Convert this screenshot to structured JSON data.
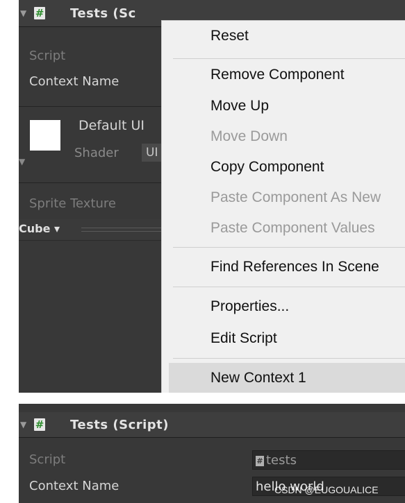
{
  "top": {
    "header": {
      "title": "Tests (Sc",
      "foldout": "▼",
      "icon_glyph": "#"
    },
    "fields": {
      "script_label": "Script",
      "context_name_label": "Context Name"
    },
    "material": {
      "name": "Default UI",
      "shader_label": "Shader",
      "shader_value": "UI",
      "foldout": "▼"
    },
    "sprite_texture_label": "Sprite Texture",
    "toolbar": {
      "dropdown": "Cube ▾"
    },
    "context_menu": {
      "items": [
        {
          "label": "Reset",
          "enabled": true
        },
        {
          "label": "Remove Component",
          "enabled": true
        },
        {
          "label": "Move Up",
          "enabled": true
        },
        {
          "label": "Move Down",
          "enabled": false
        },
        {
          "label": "Copy Component",
          "enabled": true
        },
        {
          "label": "Paste Component As New",
          "enabled": false
        },
        {
          "label": "Paste Component Values",
          "enabled": false
        },
        {
          "label": "Find References In Scene",
          "enabled": true
        },
        {
          "label": "Properties...",
          "enabled": true
        },
        {
          "label": "Edit Script",
          "enabled": true
        },
        {
          "label": "New Context 1",
          "enabled": true,
          "highlighted": true
        }
      ]
    }
  },
  "bottom": {
    "header": {
      "title": "Tests (Script)",
      "foldout": "▼",
      "icon_glyph": "#"
    },
    "fields": {
      "script_label": "Script",
      "script_value": "tests",
      "context_name_label": "Context Name",
      "context_name_value": "hello world"
    },
    "watermark": "CSDN @EUGOUALICE"
  },
  "colors": {
    "panel_bg": "#383838",
    "menu_bg": "#f0f0f0",
    "menu_highlight": "#dadada",
    "script_icon_green": "#2f8f2f"
  }
}
